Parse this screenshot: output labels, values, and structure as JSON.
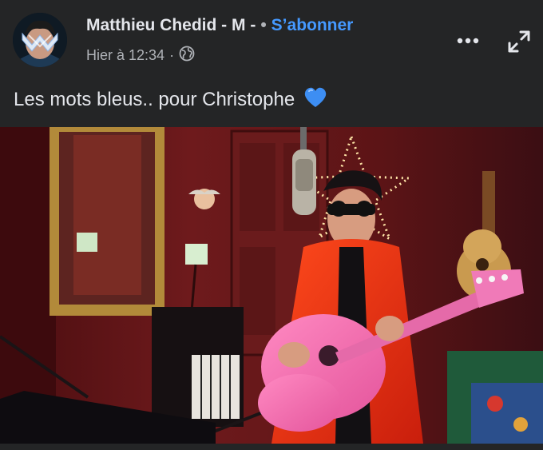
{
  "post": {
    "author": "Matthieu Chedid - M -",
    "separator": "•",
    "subscribe_label": "S’abonner",
    "timestamp": "Hier à 12:34",
    "meta_separator": "·",
    "audience_icon": "globe-icon",
    "text": "Les mots bleus.. pour Christophe",
    "emoji": "blue-heart",
    "accent_color": "#4599ff"
  },
  "actions": {
    "more_icon": "more-dots-icon",
    "expand_icon": "expand-icon"
  },
  "media": {
    "type": "video-still"
  }
}
